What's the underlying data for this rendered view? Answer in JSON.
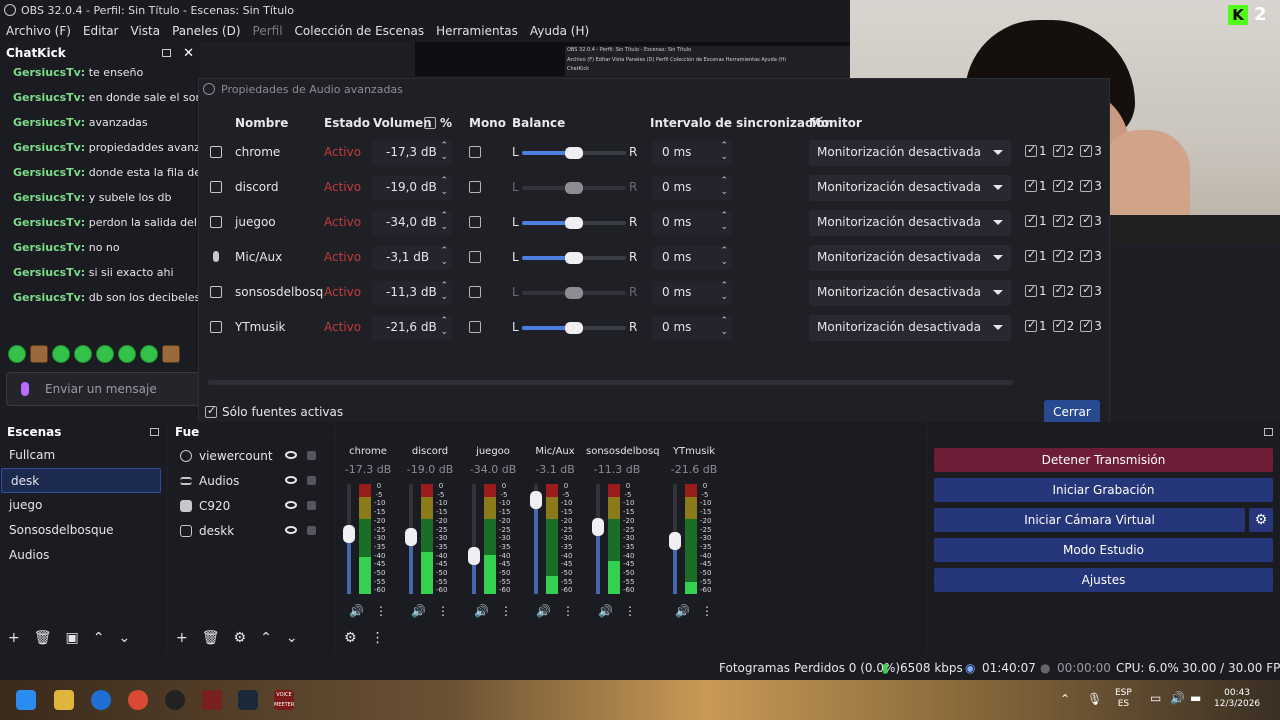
{
  "window": {
    "title": "OBS 32.0.4 - Perfil: Sin Título - Escenas: Sin Título"
  },
  "menu": [
    {
      "label": "Archivo (F)",
      "enabled": true
    },
    {
      "label": "Editar",
      "enabled": true
    },
    {
      "label": "Vista",
      "enabled": true
    },
    {
      "label": "Paneles (D)",
      "enabled": true
    },
    {
      "label": "Perfil",
      "enabled": false
    },
    {
      "label": "Colección de Escenas",
      "enabled": true
    },
    {
      "label": "Herramientas",
      "enabled": true
    },
    {
      "label": "Ayuda (H)",
      "enabled": true
    }
  ],
  "chat": {
    "title": "ChatKick",
    "messages": [
      {
        "user": "GersiucsTv:",
        "text": "te enseño"
      },
      {
        "user": "GersiucsTv:",
        "text": "en donde sale el sonido"
      },
      {
        "user": "GersiucsTv:",
        "text": "avanzadas"
      },
      {
        "user": "GersiucsTv:",
        "text": "propiedaddes avanzadas"
      },
      {
        "user": "GersiucsTv:",
        "text": "donde esta la fila de vo"
      },
      {
        "user": "GersiucsTv:",
        "text": "y subele los db"
      },
      {
        "user": "GersiucsTv:",
        "text": "perdon la salida del mic"
      },
      {
        "user": "GersiucsTv:",
        "text": "no no"
      },
      {
        "user": "GersiucsTv:",
        "text": "si sii exacto ahi"
      },
      {
        "user": "GersiucsTv:",
        "text": "db son los decibeles de"
      }
    ],
    "input_placeholder": "Enviar un mensaje"
  },
  "mini_preview": {
    "line1": "OBS 32.0.4 - Perfil: Sin Título - Escenas: Sin Título",
    "line2": "Archivo (F)   Editar   Vista   Paneles (D)   Perfil   Colección de Escenas   Herramientas   Ayuda (H)",
    "line3": "ChatKick"
  },
  "kick_badge": {
    "count": "2"
  },
  "dialog": {
    "title": "Propiedades de Audio avanzadas",
    "headers": {
      "name": "Nombre",
      "status": "Estado",
      "volume": "Volumen",
      "percent": "%",
      "mono": "Mono",
      "balance": "Balance",
      "sync": "Intervalo de sincronización",
      "monitor": "Monitor"
    },
    "rows": [
      {
        "name": "chrome",
        "status": "Activo",
        "volume": "-17,3 dB",
        "mono": false,
        "balance_enabled": true,
        "balance": 0.5,
        "sync": "0 ms",
        "monitor": "Monitorización desactivada",
        "icon": "speaker-icon"
      },
      {
        "name": "discord",
        "status": "Activo",
        "volume": "-19,0 dB",
        "mono": false,
        "balance_enabled": false,
        "balance": 0.5,
        "sync": "0 ms",
        "monitor": "Monitorización desactivada",
        "icon": "speaker-icon"
      },
      {
        "name": "juegoo",
        "status": "Activo",
        "volume": "-34,0 dB",
        "mono": false,
        "balance_enabled": true,
        "balance": 0.5,
        "sync": "0 ms",
        "monitor": "Monitorización desactivada",
        "icon": "speaker-icon"
      },
      {
        "name": "Mic/Aux",
        "status": "Activo",
        "volume": "-3,1 dB",
        "mono": false,
        "balance_enabled": true,
        "balance": 0.5,
        "sync": "0 ms",
        "monitor": "Monitorización desactivada",
        "icon": "microphone-icon"
      },
      {
        "name": "sonsosdelbosq",
        "status": "Activo",
        "volume": "-11,3 dB",
        "mono": false,
        "balance_enabled": false,
        "balance": 0.5,
        "sync": "0 ms",
        "monitor": "Monitorización desactivada",
        "icon": "speaker-icon"
      },
      {
        "name": "YTmusik",
        "status": "Activo",
        "volume": "-21,6 dB",
        "mono": false,
        "balance_enabled": true,
        "balance": 0.5,
        "sync": "0 ms",
        "monitor": "Monitorización desactivada",
        "icon": "speaker-icon"
      }
    ],
    "balance_left": "L",
    "balance_right": "R",
    "tracks": [
      "1",
      "2",
      "3"
    ],
    "only_active_label": "Sólo fuentes activas",
    "close_label": "Cerrar"
  },
  "scenes": {
    "title": "Escenas",
    "items": [
      "Fullcam",
      "desk",
      "juego",
      "Sonsosdelbosque",
      "Audios"
    ],
    "selected": "desk"
  },
  "sources": {
    "title": "Fue",
    "items": [
      {
        "name": "viewercount",
        "icon": "globe-icon"
      },
      {
        "name": "Audios",
        "icon": "list-icon"
      },
      {
        "name": "C920",
        "icon": "camera-icon"
      },
      {
        "name": "deskk",
        "icon": "monitor-icon"
      }
    ]
  },
  "mixer": {
    "channels": [
      {
        "name": "chrome",
        "db": "-17.3 dB",
        "fader": 0.55,
        "level": 0.62
      },
      {
        "name": "discord",
        "db": "-19.0 dB",
        "fader": 0.52,
        "level": 0.7
      },
      {
        "name": "juegoo",
        "db": "-34.0 dB",
        "fader": 0.32,
        "level": 0.65
      },
      {
        "name": "Mic/Aux",
        "db": "-3.1 dB",
        "fader": 0.92,
        "level": 0.3
      },
      {
        "name": "sonsosdelbosq",
        "db": "-11.3 dB",
        "fader": 0.63,
        "level": 0.55
      },
      {
        "name": "YTmusik",
        "db": "-21.6 dB",
        "fader": 0.48,
        "level": 0.2
      }
    ],
    "scale": [
      "0",
      "-5",
      "-10",
      "-15",
      "-20",
      "-25",
      "-30",
      "-35",
      "-40",
      "-45",
      "-50",
      "-55",
      "-60"
    ]
  },
  "controls": {
    "stop_stream": "Detener Transmisión",
    "start_recording": "Iniciar Grabación",
    "start_virtual_cam": "Iniciar Cámara Virtual",
    "studio_mode": "Modo Estudio",
    "settings": "Ajustes"
  },
  "status": {
    "dropped_frames": "Fotogramas Perdidos 0 (0.0%)",
    "bitrate": "6508 kbps",
    "stream_time": "01:40:07",
    "rec_time": "00:00:00",
    "cpu": "CPU: 6.0%",
    "fps": "30.00 / 30.00 FPS"
  },
  "taskbar": {
    "lang": "ESP",
    "lang2": "ES",
    "time": "00:43",
    "date": "12/3/2026",
    "voicemeeter": "VOICE MEETER"
  }
}
